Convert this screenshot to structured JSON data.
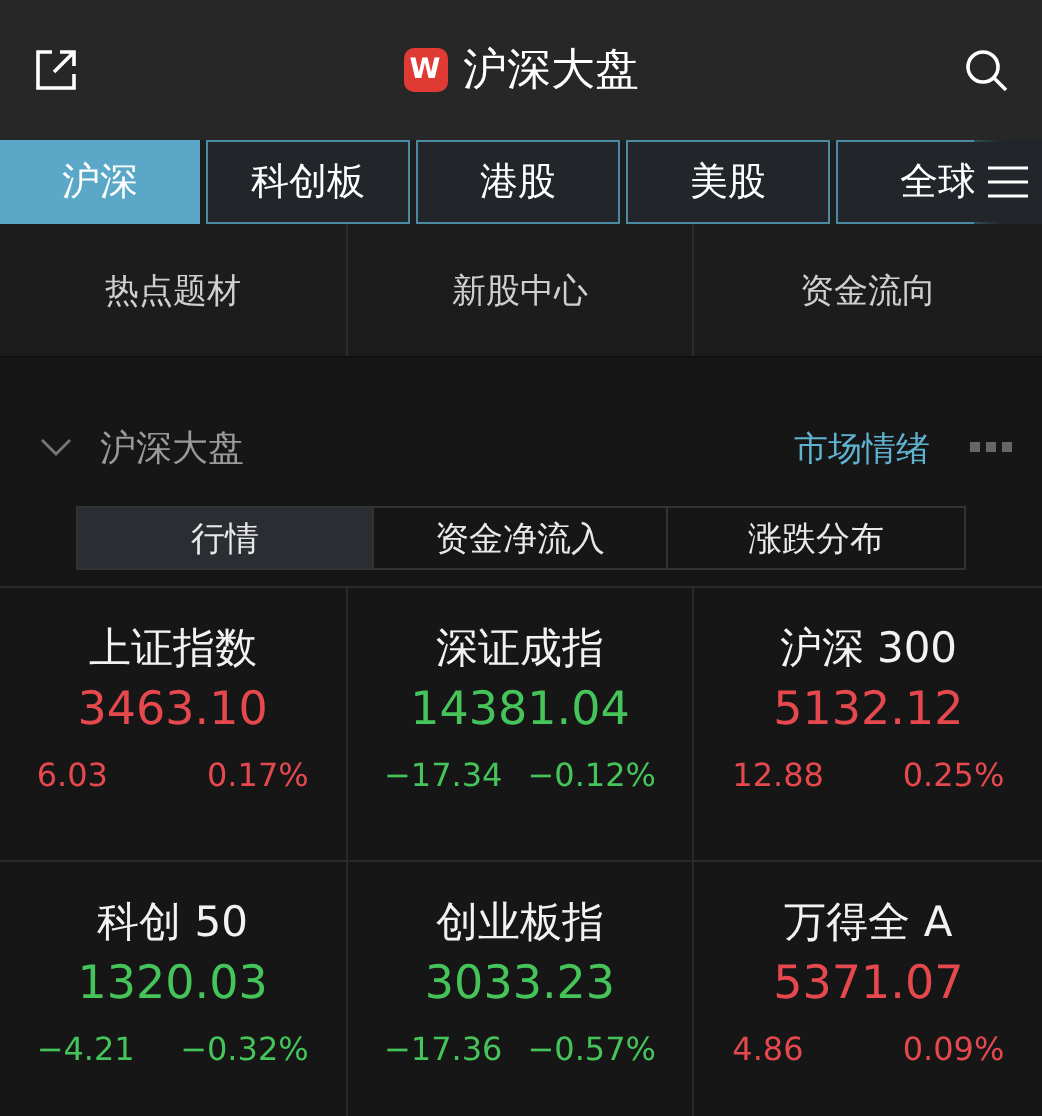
{
  "header": {
    "title": "沪深大盘",
    "logo": "W"
  },
  "tabs": [
    {
      "label": "沪深",
      "selected": true
    },
    {
      "label": "科创板",
      "selected": false
    },
    {
      "label": "港股",
      "selected": false
    },
    {
      "label": "美股",
      "selected": false
    },
    {
      "label": "全球",
      "selected": false
    }
  ],
  "quick_links": [
    "热点题材",
    "新股中心",
    "资金流向"
  ],
  "section": {
    "title": "沪深大盘",
    "expanded": true,
    "link": "市场情绪"
  },
  "segments": [
    {
      "label": "行情",
      "selected": true
    },
    {
      "label": "资金净流入",
      "selected": false
    },
    {
      "label": "涨跌分布",
      "selected": false
    }
  ],
  "indices": [
    {
      "name": "上证指数",
      "value": "3463.10",
      "change": "6.03",
      "percent": "0.17%",
      "color": "#e5484d"
    },
    {
      "name": "深证成指",
      "value": "14381.04",
      "change": "−17.34",
      "percent": "−0.12%",
      "color": "#45c45a"
    },
    {
      "name": "沪深 300",
      "value": "5132.12",
      "change": "12.88",
      "percent": "0.25%",
      "color": "#e5484d"
    },
    {
      "name": "科创 50",
      "value": "1320.03",
      "change": "−4.21",
      "percent": "−0.32%",
      "color": "#45c45a"
    },
    {
      "name": "创业板指",
      "value": "3033.23",
      "change": "−17.36",
      "percent": "−0.57%",
      "color": "#45c45a"
    },
    {
      "name": "万得全 A",
      "value": "5371.07",
      "change": "4.86",
      "percent": "0.09%",
      "color": "#e5484d"
    }
  ]
}
